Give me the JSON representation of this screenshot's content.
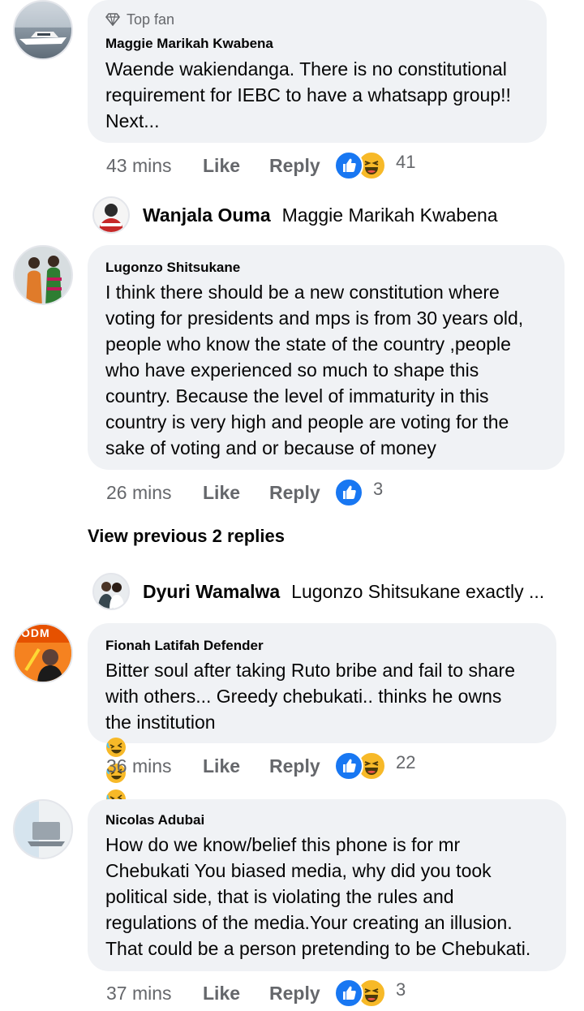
{
  "comments": [
    {
      "top_fan_label": "Top fan",
      "author": "Maggie Marikah Kwabena",
      "text": "Waende wakiendanga. There is no constitutional\nrequirement for IEBC to have a whatsapp group!!\nNext...",
      "time": "43 mins",
      "like_label": "Like",
      "reply_label": "Reply",
      "reaction_count": "41",
      "reactions": [
        "like",
        "haha"
      ]
    },
    {
      "author": "Lugonzo Shitsukane",
      "text": "I think there should be a new constitution where\nvoting for presidents and mps is from 30 years old,\npeople who know the state of the country ,people\nwho have experienced so much to shape this\ncountry. Because the level of immaturity in this\ncountry is very high and people are voting for the\nsake of voting and or because of money",
      "time": "26 mins",
      "like_label": "Like",
      "reply_label": "Reply",
      "reaction_count": "3",
      "reactions": [
        "like"
      ]
    },
    {
      "author": "Fionah Latifah Defender",
      "text": "Bitter soul after taking Ruto bribe and fail to share\nwith others... Greedy chebukati.. thinks he owns\nthe institution",
      "emoji": [
        "rofl",
        "rofl",
        "rofl",
        "rofl"
      ],
      "time": "36 mins",
      "like_label": "Like",
      "reply_label": "Reply",
      "reaction_count": "22",
      "reactions": [
        "like",
        "haha"
      ]
    },
    {
      "author": "Nicolas Adubai",
      "text": "How do we know/belief this phone is for mr\nChebukati You biased media,  why did you took\npolitical side, that is  violating the rules and\nregulations of the media.Your creating an illusion.\nThat could be a person pretending to be Chebukati.",
      "time": "37 mins",
      "like_label": "Like",
      "reply_label": "Reply",
      "reaction_count": "3",
      "reactions": [
        "like",
        "haha"
      ]
    }
  ],
  "replies": [
    {
      "author": "Wanjala Ouma",
      "text": "Maggie Marikah Kwabena"
    },
    {
      "author": "Dyuri Wamalwa",
      "text": "Lugonzo Shitsukane exactly ..."
    }
  ],
  "view_previous_label": "View previous 2 replies",
  "avatar_badge_text": "ODM",
  "colors": {
    "like_blue": "#1877f2",
    "haha_yellow": "#f7b928",
    "bubble": "#f0f2f5",
    "secondary_text": "#65676b"
  }
}
